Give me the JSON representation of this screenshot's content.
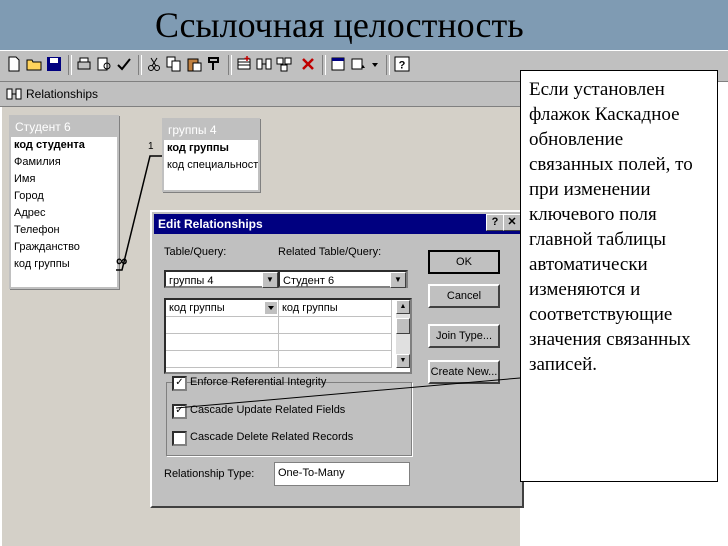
{
  "slide": {
    "title": "Ссылочная целостность"
  },
  "toolbar": {
    "icons": [
      "new-icon",
      "open-icon",
      "save-icon",
      "print-icon",
      "print-preview-icon",
      "spelling-icon",
      "cut-icon",
      "copy-icon",
      "paste-icon",
      "format-painter-icon",
      "show-table-icon",
      "show-direct-icon",
      "show-all-icon",
      "delete-icon",
      "properties-icon",
      "new-object-icon",
      "help-icon"
    ]
  },
  "relationships_window": {
    "title": "Relationships",
    "table_student": {
      "caption": "Студент 6",
      "fields": [
        "код студента",
        "Фамилия",
        "Имя",
        "Город",
        "Адрес",
        "Телефон",
        "Гражданство",
        "код группы"
      ]
    },
    "table_groups": {
      "caption": "группы 4",
      "fields": [
        "код группы",
        "код специальности"
      ]
    },
    "link_one": "1",
    "link_many": "∞"
  },
  "dialog": {
    "title": "Edit Relationships",
    "help_button": "?",
    "close_button": "✕",
    "table_query_label": "Table/Query:",
    "related_label": "Related Table/Query:",
    "table_query_value": "группы 4",
    "related_value": "Студент 6",
    "grid_left": "код группы",
    "grid_right": "код группы",
    "ok": "OK",
    "cancel": "Cancel",
    "join_type": "Join Type...",
    "create_new": "Create New...",
    "enforce": "Enforce Referential Integrity",
    "cascade_update": "Cascade Update Related Fields",
    "cascade_delete": "Cascade Delete Related Records",
    "relationship_type_label": "Relationship Type:",
    "relationship_type_value": "One-To-Many",
    "enforce_checked": "✓",
    "cascade_update_checked": "✓"
  },
  "note": {
    "text": "Если установлен флажок Каскадное обновление связанных полей, то при изменении ключевого поля главной таблицы автоматически изменяются и соответствующие значения связанных записей."
  }
}
